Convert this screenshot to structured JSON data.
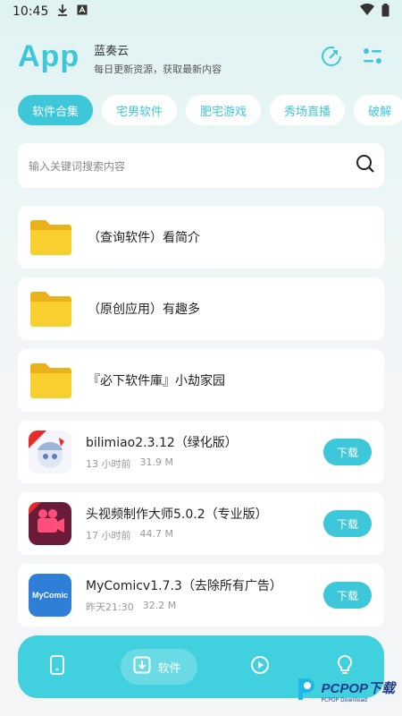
{
  "status_bar": {
    "time": "10:45"
  },
  "header": {
    "logo": "App",
    "title": "蓝奏云",
    "subtitle": "每日更新资源，获取最新内容"
  },
  "tabs": [
    {
      "label": "软件合集",
      "active": true
    },
    {
      "label": "宅男软件",
      "active": false
    },
    {
      "label": "肥宅游戏",
      "active": false
    },
    {
      "label": "秀场直播",
      "active": false
    },
    {
      "label": "破解",
      "active": false
    }
  ],
  "search": {
    "placeholder": "输入关键词搜索内容"
  },
  "folders": [
    {
      "title": "（查询软件）看简介"
    },
    {
      "title": "（原创应用）有趣多"
    },
    {
      "title": "『必下软件庫』小劫家园"
    }
  ],
  "apps": [
    {
      "name": "bilimiao2.3.12（绿化版）",
      "time": "13 小时前",
      "size": "31.9 M",
      "button": "下载",
      "icon": "bilimiao-icon"
    },
    {
      "name": "头视频制作大师5.0.2（专业版）",
      "time": "17 小时前",
      "size": "44.7 M",
      "button": "下载",
      "icon": "video-maker-icon"
    },
    {
      "name": "MyComicv1.7.3（去除所有广告）",
      "time": "昨天21:30",
      "size": "32.2 M",
      "button": "下载",
      "icon": "mycomic-icon",
      "icon_text": "MyComic"
    }
  ],
  "bottom_nav": {
    "active_label": "软件"
  },
  "watermark": {
    "text": "PCPOP下载",
    "sub": "PCPOP Download"
  },
  "colors": {
    "accent": "#3ec7d8",
    "nav": "#41d0dd",
    "folder": "#f7cf2e"
  }
}
